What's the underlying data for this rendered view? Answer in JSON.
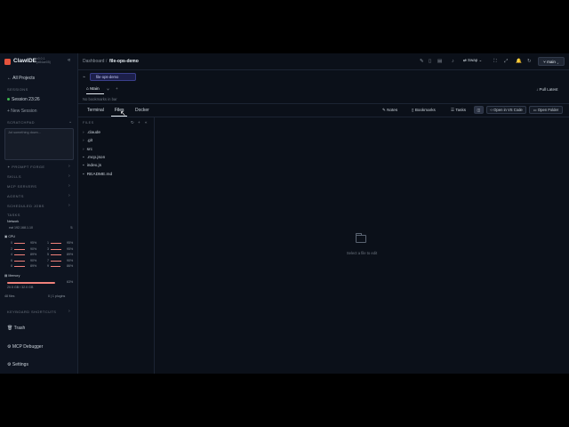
{
  "app": {
    "title": "ClawIDE",
    "version_line1": "v0.0.1",
    "version_line2": "(d84ae05)"
  },
  "sidebar": {
    "all_projects": "All Projects",
    "sessions_header": "SESSIONS",
    "session_name": "Session 23:26",
    "new_session": "+ New Session",
    "scratchpad_header": "SCRATCHPAD",
    "scratchpad_placeholder": "Jot something down...",
    "sections": [
      "PROMPT FORGE",
      "SKILLS",
      "MCP SERVERS",
      "AGENTS",
      "SCHEDULED JOBS",
      "TASKS"
    ],
    "network_label": "Network",
    "network_detail": "eat 192.168.1.10",
    "cpu_label": "CPU",
    "cpu_rows": [
      {
        "left_id": "0",
        "left_pct": "95%",
        "right_id": "1",
        "right_pct": "95%"
      },
      {
        "left_id": "2",
        "left_pct": "90%",
        "right_id": "3",
        "right_pct": "95%"
      },
      {
        "left_id": "4",
        "left_pct": "89%",
        "right_id": "5",
        "right_pct": "89%"
      },
      {
        "left_id": "6",
        "left_pct": "90%",
        "right_id": "7",
        "right_pct": "90%"
      },
      {
        "left_id": "8",
        "left_pct": "89%",
        "right_id": "9",
        "right_pct": "86%"
      }
    ],
    "memory_label": "Memory",
    "memory_pct": "63%",
    "memory_detail": "20.5 GB / 32.0 GB",
    "plugins_left": "48 files",
    "plugins_right": "0 | 1 plugins",
    "shortcuts": "KEYBOARD SHORTCUTS",
    "trash": "Trash",
    "mcp_debugger": "MCP Debugger",
    "settings": "Settings"
  },
  "header": {
    "breadcrumb_root": "Dashboard",
    "breadcrumb_sep": "/",
    "breadcrumb_current": "file-ops-demo",
    "swap_label": "Swap",
    "main_button": "main"
  },
  "branch": {
    "pill_label": "file-ops-demo",
    "main_tab": "Main",
    "no_bookmarks": "No bookmarks in bar",
    "pull_latest": "Pull Latest"
  },
  "tabs": {
    "terminal": "Terminal",
    "files": "Files",
    "docker": "Docker"
  },
  "tools": {
    "notes": "Notes",
    "bookmarks": "Bookmarks",
    "tasks": "Tasks",
    "open_vscode": "Open in VS Code",
    "open_folder": "Open Folder"
  },
  "files": {
    "header": "FILES",
    "items": [
      {
        "name": ".claude",
        "type": "folder"
      },
      {
        "name": ".git",
        "type": "folder"
      },
      {
        "name": "src",
        "type": "folder"
      },
      {
        "name": ".mcp.json",
        "type": "file"
      },
      {
        "name": "index.js",
        "type": "file"
      },
      {
        "name": "README.md",
        "type": "file"
      }
    ]
  },
  "editor": {
    "empty_message": "Select a file to edit"
  },
  "colors": {
    "accent_red": "#e5533d",
    "bar_red": "#f0817a",
    "status_green": "#3fb950",
    "branch_pill": "#1c1f4a"
  }
}
